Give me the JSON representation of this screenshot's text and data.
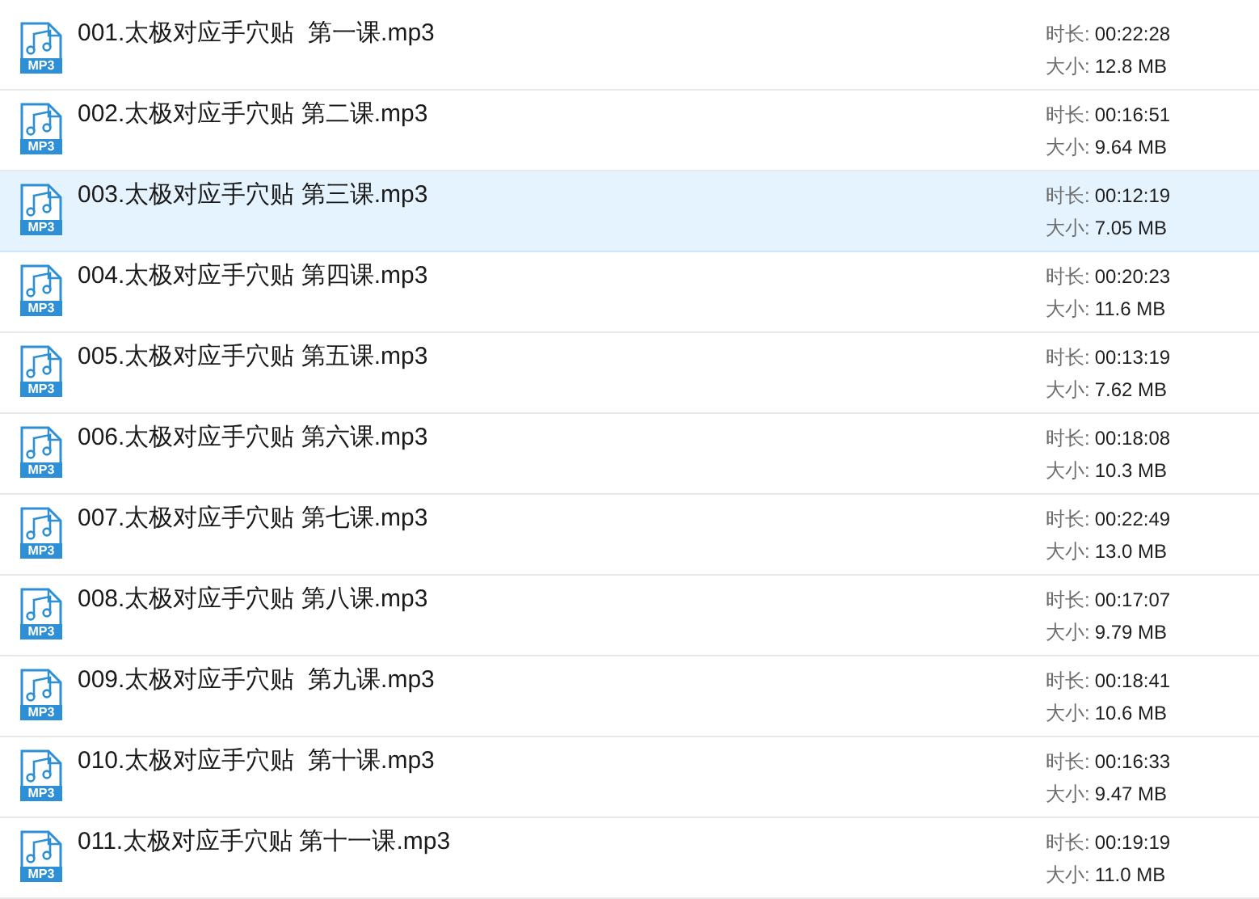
{
  "files": [
    {
      "name": "001.太极对应手穴贴  第一课.mp3",
      "icon_text": "MP3",
      "duration_label": "时长:",
      "duration": "00:22:28",
      "size_label": "大小:",
      "size": "12.8 MB",
      "selected": false
    },
    {
      "name": "002.太极对应手穴贴 第二课.mp3",
      "icon_text": "MP3",
      "duration_label": "时长:",
      "duration": "00:16:51",
      "size_label": "大小:",
      "size": "9.64 MB",
      "selected": false
    },
    {
      "name": "003.太极对应手穴贴 第三课.mp3",
      "icon_text": "MP3",
      "duration_label": "时长:",
      "duration": "00:12:19",
      "size_label": "大小:",
      "size": "7.05 MB",
      "selected": true
    },
    {
      "name": "004.太极对应手穴贴 第四课.mp3",
      "icon_text": "MP3",
      "duration_label": "时长:",
      "duration": "00:20:23",
      "size_label": "大小:",
      "size": "11.6 MB",
      "selected": false
    },
    {
      "name": "005.太极对应手穴贴 第五课.mp3",
      "icon_text": "MP3",
      "duration_label": "时长:",
      "duration": "00:13:19",
      "size_label": "大小:",
      "size": "7.62 MB",
      "selected": false
    },
    {
      "name": "006.太极对应手穴贴 第六课.mp3",
      "icon_text": "MP3",
      "duration_label": "时长:",
      "duration": "00:18:08",
      "size_label": "大小:",
      "size": "10.3 MB",
      "selected": false
    },
    {
      "name": "007.太极对应手穴贴 第七课.mp3",
      "icon_text": "MP3",
      "duration_label": "时长:",
      "duration": "00:22:49",
      "size_label": "大小:",
      "size": "13.0 MB",
      "selected": false
    },
    {
      "name": "008.太极对应手穴贴 第八课.mp3",
      "icon_text": "MP3",
      "duration_label": "时长:",
      "duration": "00:17:07",
      "size_label": "大小:",
      "size": "9.79 MB",
      "selected": false
    },
    {
      "name": "009.太极对应手穴贴  第九课.mp3",
      "icon_text": "MP3",
      "duration_label": "时长:",
      "duration": "00:18:41",
      "size_label": "大小:",
      "size": "10.6 MB",
      "selected": false
    },
    {
      "name": "010.太极对应手穴贴  第十课.mp3",
      "icon_text": "MP3",
      "duration_label": "时长:",
      "duration": "00:16:33",
      "size_label": "大小:",
      "size": "9.47 MB",
      "selected": false
    },
    {
      "name": "011.太极对应手穴贴 第十一课.mp3",
      "icon_text": "MP3",
      "duration_label": "时长:",
      "duration": "00:19:19",
      "size_label": "大小:",
      "size": "11.0 MB",
      "selected": false
    }
  ]
}
